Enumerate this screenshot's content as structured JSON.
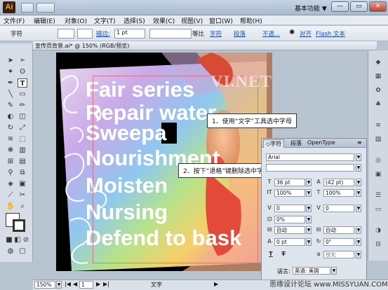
{
  "titlebar": {
    "app_logo": "Ai",
    "workspace": "基本功能 ▼"
  },
  "window_controls": {
    "minimize": "—",
    "restore": "▭",
    "close": "✕"
  },
  "menu": [
    "文件(F)",
    "编辑(E)",
    "对象(O)",
    "文字(T)",
    "选择(S)",
    "效果(C)",
    "视图(V)",
    "窗口(W)",
    "帮助(H)"
  ],
  "controlbar": {
    "tool_name": "字符",
    "stroke_label": "描边:",
    "stroke_value": "1 pt",
    "stroke_style": "等比",
    "char_link": "字符",
    "para_link": "段落",
    "opacity_link": "不透...",
    "align_link": "对齐",
    "flash_link": "Flash 文本"
  },
  "document": {
    "tab_label": "宣传页背景.ai* @ 150% (RGB/预览)",
    "text_lines": [
      "Fair series",
      "Repair water",
      "Sweepa",
      "Nourishment",
      "Moisten",
      "Nursing",
      "Defend to bask"
    ],
    "watermark": "VI.NET"
  },
  "callouts": {
    "step1": "1、使用“文字”工具选中字母",
    "step2": "2、按下“退格”键删除选中字母"
  },
  "character_panel": {
    "tabs": [
      "◇字符",
      "段落",
      "OpenType"
    ],
    "font_family": "Arial",
    "font_size": "36 pt",
    "leading": "(42 pt)",
    "vertical_scale": "100%",
    "horizontal_scale": "100%",
    "kerning": "0",
    "tracking": "0",
    "shift_percent": "0%",
    "aki_left": "自动",
    "aki_right": "自动",
    "baseline_shift": "0 pt",
    "rotation": "0°",
    "underline_icon": "T",
    "strike_icon": "T",
    "smoothing": "锐化",
    "language_label": "语言:",
    "language_value": "英语: 美国"
  },
  "statusbar": {
    "zoom": "150%",
    "page": "1",
    "status_text": "文字"
  },
  "footer_watermark": "思缘设计论坛 www.MISSYUAN.COM"
}
